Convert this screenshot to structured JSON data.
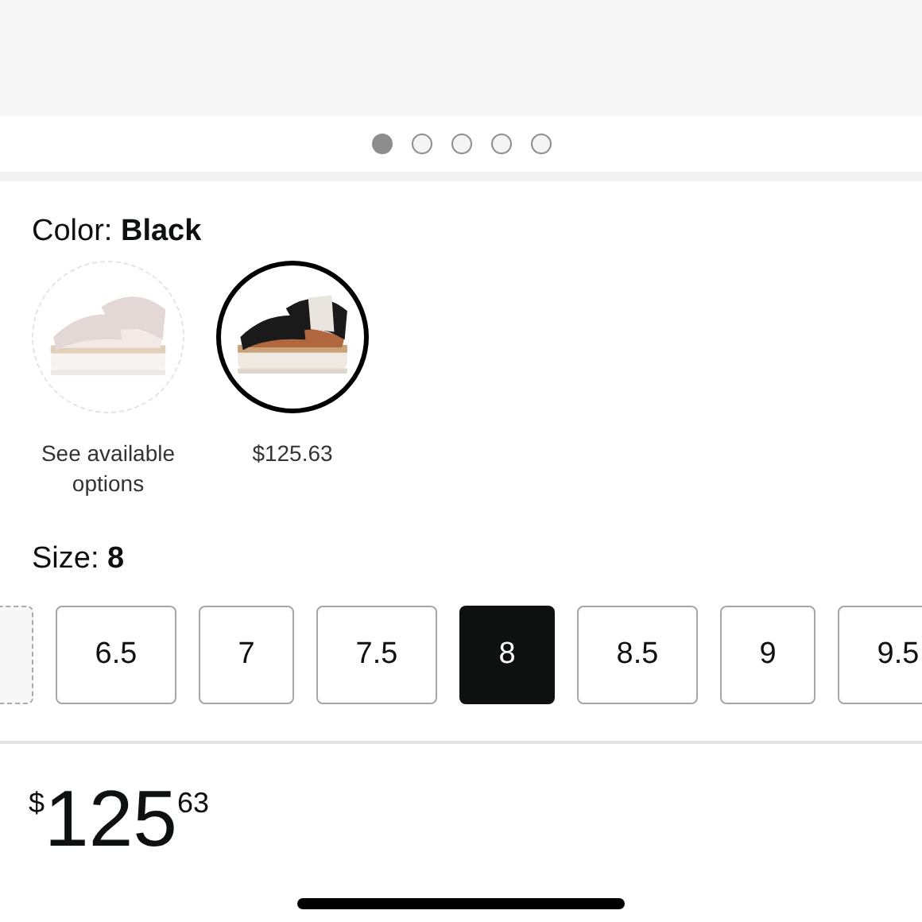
{
  "carousel": {
    "dots": [
      {
        "selected": true
      },
      {
        "selected": false
      },
      {
        "selected": false
      },
      {
        "selected": false
      },
      {
        "selected": false
      }
    ]
  },
  "color": {
    "label": "Color:",
    "value": "Black",
    "swatches": [
      {
        "kind": "picture",
        "caption": "See available options",
        "available": false,
        "selected": false
      },
      {
        "kind": "picture",
        "caption": "$125.63",
        "available": true,
        "selected": true
      }
    ]
  },
  "size": {
    "label": "Size:",
    "value": "8",
    "options": [
      {
        "kind": "partial",
        "selected": false
      },
      {
        "kind": "size",
        "label": "6.5",
        "selected": false
      },
      {
        "kind": "size",
        "label": "7",
        "selected": false
      },
      {
        "kind": "size",
        "label": "7.5",
        "selected": false
      },
      {
        "kind": "size",
        "label": "8",
        "selected": true
      },
      {
        "kind": "size",
        "label": "8.5",
        "selected": false
      },
      {
        "kind": "size",
        "label": "9",
        "selected": false
      },
      {
        "kind": "size",
        "label": "9.5",
        "selected": false
      }
    ]
  },
  "price": {
    "currency": "$",
    "whole": "125",
    "fraction": "63"
  }
}
